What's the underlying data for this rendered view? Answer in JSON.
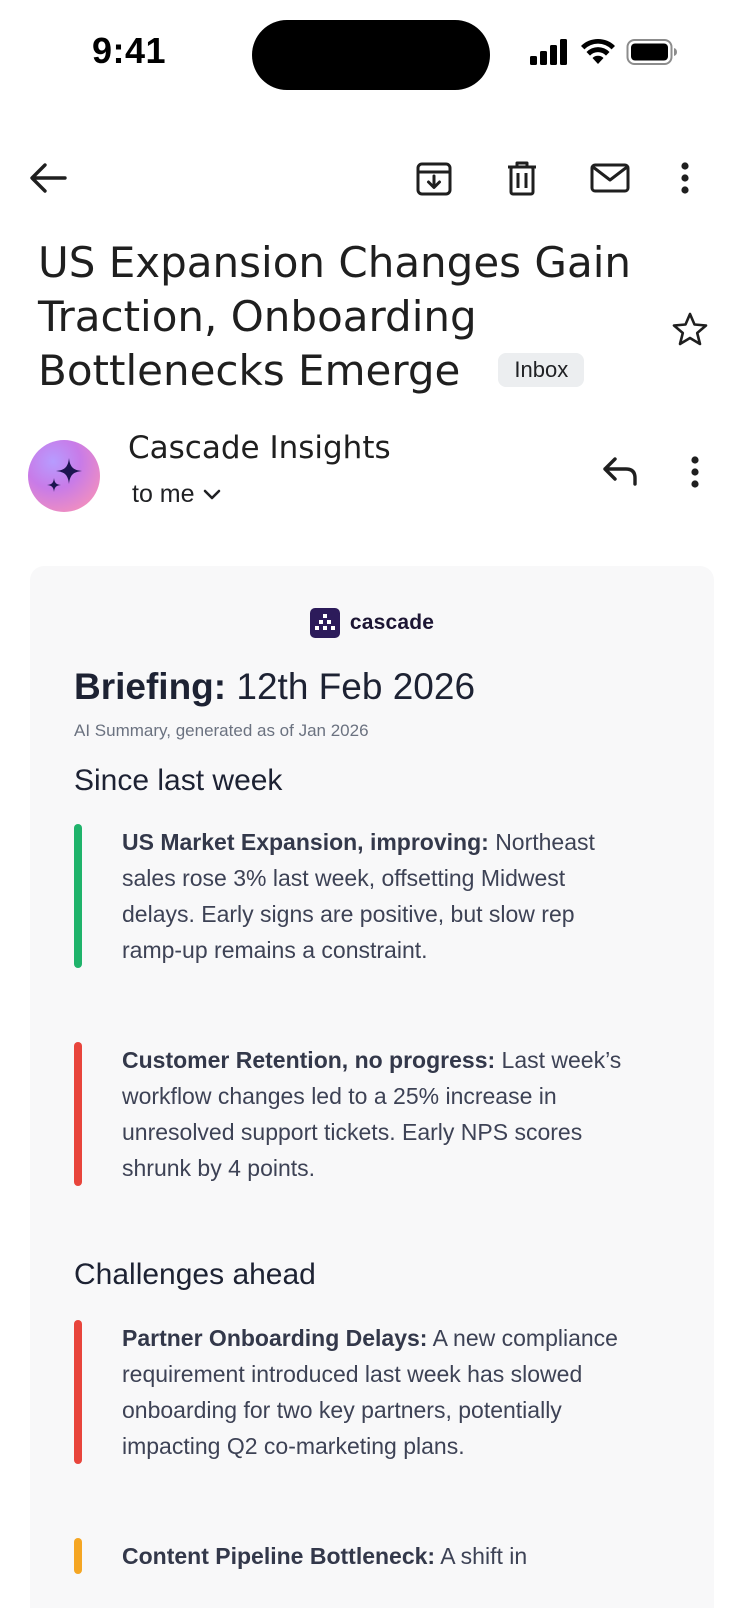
{
  "status_bar": {
    "time": "9:41"
  },
  "toolbar": {
    "back": "back-arrow-icon",
    "archive": "archive-icon",
    "delete": "trash-icon",
    "mark_unread": "mail-icon",
    "more": "more-vertical-icon"
  },
  "email": {
    "subject": "US Expansion Changes Gain Traction, Onboarding Bottlenecks Emerge",
    "label": "Inbox",
    "sender": "Cascade Insights",
    "recipient": "to me"
  },
  "body": {
    "logo_text": "cascade",
    "briefing_label": "Briefing:",
    "briefing_date": "12th Feb 2026",
    "subtitle": "AI Summary, generated as of Jan 2026",
    "since_last_week": {
      "heading": "Since last week",
      "items": [
        {
          "lead": "US Market Expansion, improving:",
          "text": "Northeast sales rose 3% last week, offsetting Midwest delays. Early signs are positive, but slow rep ramp-up remains a constraint.",
          "status_color": "#1fb36b"
        },
        {
          "lead": "Customer Retention, no progress:",
          "text": "Last week’s workflow changes led to a 25% increase in unresolved support tickets. Early NPS scores shrunk by 4 points.",
          "status_color": "#e8453c"
        }
      ]
    },
    "challenges_ahead": {
      "heading": "Challenges ahead",
      "items": [
        {
          "lead": "Partner Onboarding Delays:",
          "text": "A new compliance requirement introduced last week has slowed onboarding for two key partners, potentially impacting Q2 co-marketing plans.",
          "status_color": "#e8453c"
        },
        {
          "lead": "Content Pipeline Bottleneck:",
          "text": "A shift in",
          "status_color": "#f5a623"
        }
      ]
    }
  }
}
